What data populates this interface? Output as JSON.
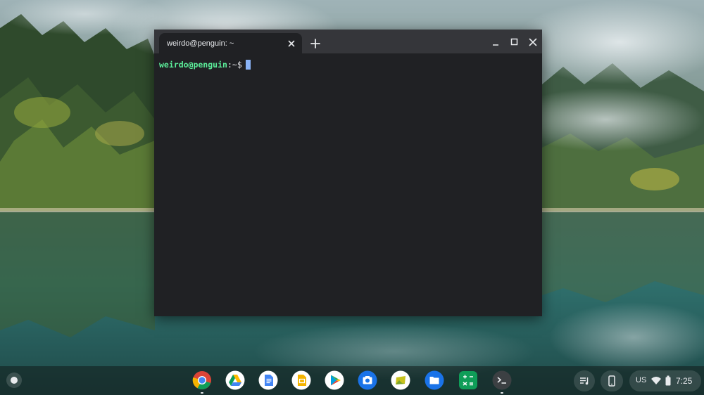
{
  "terminal": {
    "tab_title": "weirdo@penguin: ~",
    "prompt_user": "weirdo@penguin",
    "prompt_separator": ":",
    "prompt_path": "~",
    "prompt_symbol": "$"
  },
  "shelf": {
    "apps": [
      {
        "name": "Chrome",
        "icon": "chrome-icon"
      },
      {
        "name": "Google Drive",
        "icon": "drive-icon"
      },
      {
        "name": "Google Docs",
        "icon": "docs-icon"
      },
      {
        "name": "Google Slides",
        "icon": "slides-icon"
      },
      {
        "name": "Play Store",
        "icon": "play-store-icon"
      },
      {
        "name": "Camera",
        "icon": "camera-icon"
      },
      {
        "name": "Gallery",
        "icon": "gallery-icon"
      },
      {
        "name": "Files",
        "icon": "files-icon"
      },
      {
        "name": "Calculator",
        "icon": "calculator-icon"
      },
      {
        "name": "Terminal",
        "icon": "terminal-icon"
      }
    ]
  },
  "status_tray": {
    "ime": "US",
    "time": "7:25"
  },
  "colors": {
    "terminal_bg": "#202124",
    "titlebar_bg": "#35363a",
    "prompt_user": "#5cf09b",
    "cursor": "#8ab4f8"
  }
}
